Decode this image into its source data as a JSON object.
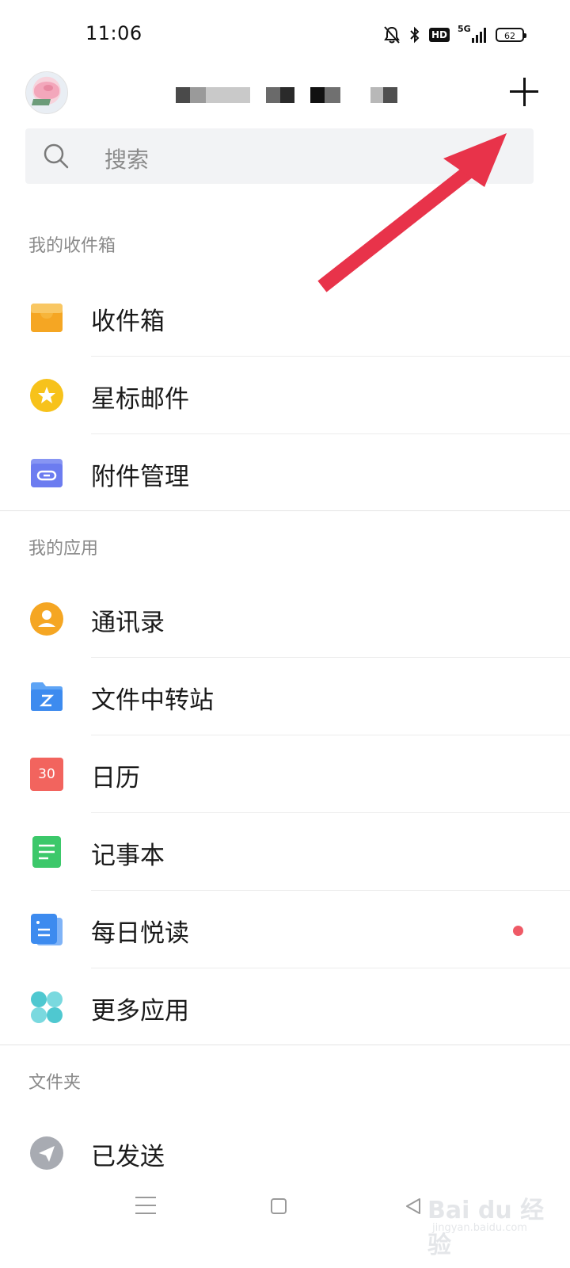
{
  "status_bar": {
    "time": "11:06",
    "network_label": "5G",
    "hd_label": "HD",
    "battery": "62",
    "icons": [
      "bell-off-icon",
      "bluetooth-icon",
      "hd-icon",
      "signal-5g-icon",
      "battery-icon"
    ]
  },
  "header": {
    "avatar": "avatar",
    "account_masked": true,
    "add_icon": "plus-icon"
  },
  "search": {
    "placeholder": "搜索",
    "icon": "search-icon"
  },
  "sections": {
    "inbox": {
      "title": "我的收件箱",
      "items": [
        {
          "label": "收件箱",
          "icon": "inbox-icon",
          "color": "#F5A623"
        },
        {
          "label": "星标邮件",
          "icon": "star-icon",
          "color": "#F7C21B"
        },
        {
          "label": "附件管理",
          "icon": "attachment-icon",
          "color": "#6C7CF0"
        }
      ]
    },
    "apps": {
      "title": "我的应用",
      "items": [
        {
          "label": "通讯录",
          "icon": "contacts-icon",
          "color": "#F5A623"
        },
        {
          "label": "文件中转站",
          "icon": "folder-icon",
          "color": "#3D8BEF"
        },
        {
          "label": "日历",
          "icon": "calendar-icon",
          "color": "#F2645E",
          "icon_text": "30"
        },
        {
          "label": "记事本",
          "icon": "notebook-icon",
          "color": "#3CC86A"
        },
        {
          "label": "每日悦读",
          "icon": "reading-icon",
          "color": "#3D8BEF",
          "badge": true
        },
        {
          "label": "更多应用",
          "icon": "more-apps-icon",
          "color": "#4FC8D0"
        }
      ]
    },
    "folders": {
      "title": "文件夹",
      "items": [
        {
          "label": "已发送",
          "icon": "sent-icon",
          "color": "#A8ABB2"
        }
      ]
    }
  },
  "colors": {
    "accent_arrow": "#E8334A",
    "badge_dot": "#EF5A66",
    "section_label": "#8A8A8A"
  },
  "watermark": {
    "main": "Bai du 经验",
    "sub": "jingyan.baidu.com"
  }
}
